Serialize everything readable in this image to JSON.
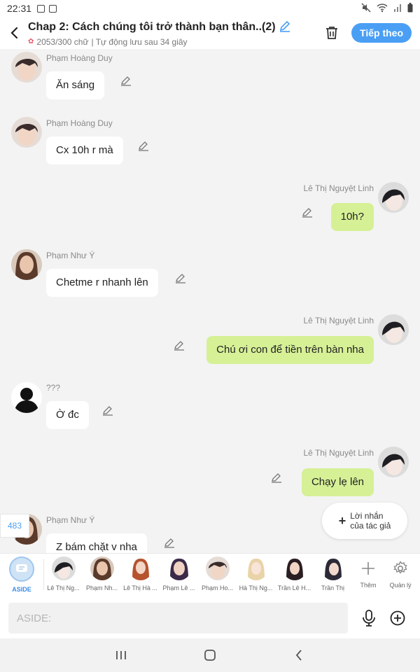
{
  "status": {
    "time": "22:31"
  },
  "header": {
    "title": "Chap 2: Cách chúng tôi trở thành bạn thân..(2)",
    "word_count": "2053/300 chữ",
    "autosave": "| Tự động lưu sau 34 giây",
    "follow_label": "Tiếp theo"
  },
  "messages": [
    {
      "side": "left",
      "sender": "Phạm Hoàng Duy",
      "text": "Ăn sáng"
    },
    {
      "side": "left",
      "sender": "Phạm Hoàng Duy",
      "text": "Cx 10h r mà"
    },
    {
      "side": "right",
      "sender": "Lê Thị Nguyệt Linh",
      "text": "10h?"
    },
    {
      "side": "left",
      "sender": "Phạm Như Ý",
      "text": "Chetme r nhanh lên"
    },
    {
      "side": "right",
      "sender": "Lê Thị Nguyệt Linh",
      "text": "Chú ơi con để tiền trên bàn nha"
    },
    {
      "side": "left",
      "sender": "???",
      "text": "Ờ đc"
    },
    {
      "side": "right",
      "sender": "Lê Thị Nguyệt Linh",
      "text": "Chạy lẹ lên"
    },
    {
      "side": "left",
      "sender": "Phạm Như Ý",
      "text": "Z bám chặt v nha"
    }
  ],
  "author_note": {
    "line1": "Lời nhắn",
    "line2": "của tác giả"
  },
  "count_badge": "483",
  "charbar": {
    "aside_label": "ASIDE",
    "characters": [
      "Lê Thị Ng...",
      "Phạm Nh...",
      "Lê Thị Hà ...",
      "Phạm Lê ...",
      "Phạm Ho...",
      "Hà Thị Ng...",
      "Trần Lê H...",
      "Trần Thị"
    ],
    "add_label": "Thêm",
    "manage_label": "Quản lý"
  },
  "input": {
    "placeholder": "ASIDE:"
  },
  "colors": {
    "accent": "#4a9ff5",
    "right_bubble": "#d6f096",
    "left_bubble": "#ffffff"
  },
  "icons": [
    "back-icon",
    "pencil-icon",
    "trash-icon",
    "edit-icon",
    "plus-icon",
    "gear-icon",
    "mic-icon",
    "add-circle-icon",
    "recent-apps-icon",
    "home-icon",
    "nav-back-icon"
  ]
}
